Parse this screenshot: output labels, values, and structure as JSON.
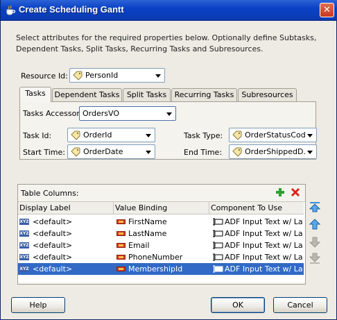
{
  "window": {
    "title": "Create Scheduling Gantt",
    "close_glyph": "✕"
  },
  "intro": "Select attributes for the required properties below.  Optionally define Subtasks, Dependent Tasks, Split Tasks, Recurring Tasks and Subresources.",
  "resource": {
    "label": "Resource Id:",
    "value": "PersonId"
  },
  "tabs": [
    {
      "label": "Tasks",
      "active": true
    },
    {
      "label": "Dependent Tasks",
      "active": false
    },
    {
      "label": "Split Tasks",
      "active": false
    },
    {
      "label": "Recurring Tasks",
      "active": false
    },
    {
      "label": "Subresources",
      "active": false
    }
  ],
  "tasks": {
    "accessor_label": "Tasks Accessor:",
    "accessor_value": "OrdersVO",
    "task_id_label": "Task Id:",
    "task_id_value": "OrderId",
    "task_type_label": "Task Type:",
    "task_type_value": "OrderStatusCode",
    "start_time_label": "Start Time:",
    "start_time_value": "OrderDate",
    "end_time_label": "End Time:",
    "end_time_value": "OrderShippedD..."
  },
  "table": {
    "label": "Table Columns:",
    "columns": [
      "Display Label",
      "Value Binding",
      "Component To Use"
    ],
    "rows": [
      {
        "display": "<default>",
        "binding": "FirstName",
        "component": "ADF Input Text w/ La...",
        "selected": false
      },
      {
        "display": "<default>",
        "binding": "LastName",
        "component": "ADF Input Text w/ La...",
        "selected": false
      },
      {
        "display": "<default>",
        "binding": "Email",
        "component": "ADF Input Text w/ La...",
        "selected": false
      },
      {
        "display": "<default>",
        "binding": "PhoneNumber",
        "component": "ADF Input Text w/ La...",
        "selected": false
      },
      {
        "display": "<default>",
        "binding": "MembershipId",
        "component": "ADF Input Text w/ La...",
        "selected": true
      }
    ]
  },
  "buttons": {
    "help": "Help",
    "ok": "OK",
    "cancel": "Cancel"
  },
  "colors": {
    "titlebar": "#0b42c6",
    "selection": "#316ac5",
    "add": "#2ea02e",
    "remove": "#d8261c"
  }
}
